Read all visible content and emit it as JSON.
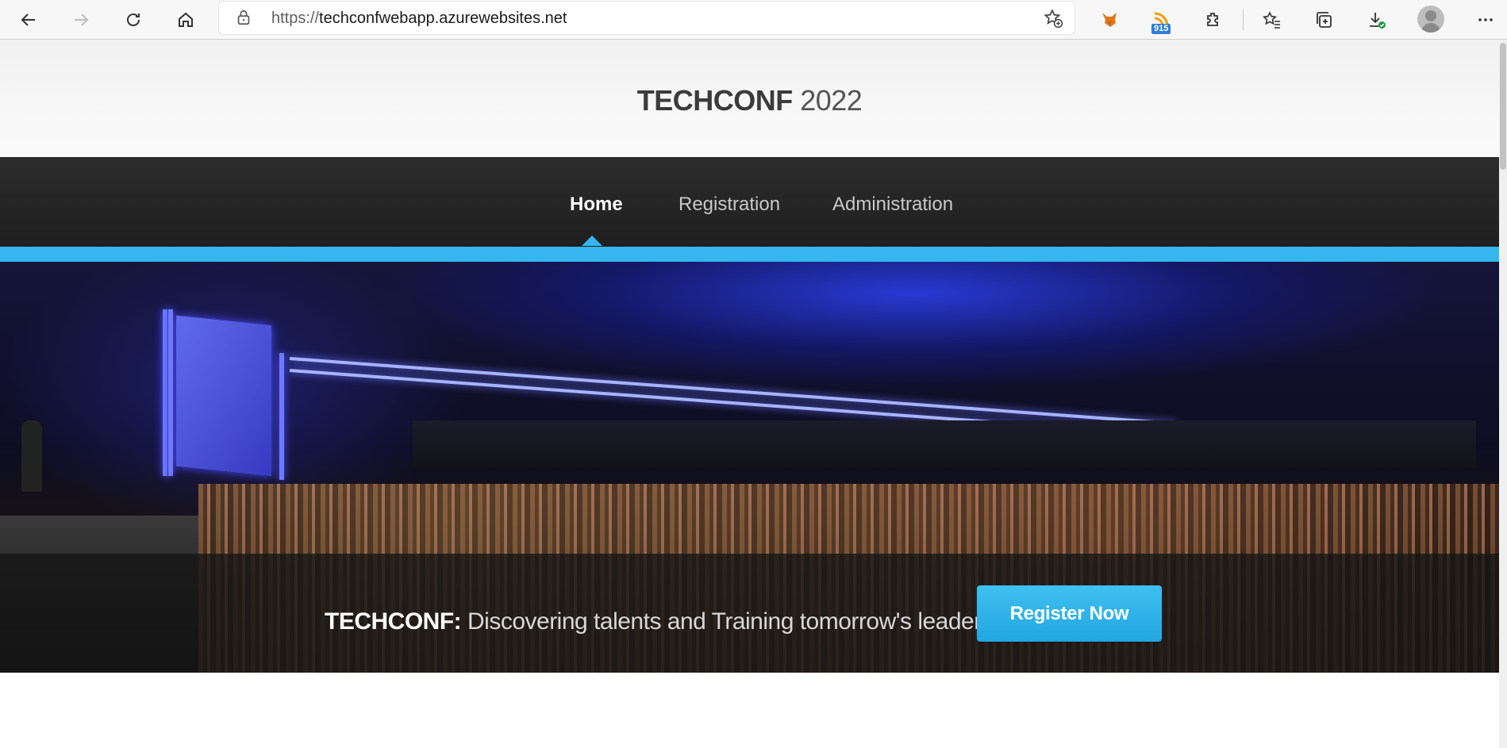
{
  "browser": {
    "url_scheme": "https://",
    "url_host": "techconfwebapp.azurewebsites.net",
    "extension_badge": "915",
    "icons": [
      "back-icon",
      "forward-icon",
      "refresh-icon",
      "home-icon",
      "lock-icon",
      "add-favorite-icon",
      "fox-extension-icon",
      "rss-extension-icon",
      "extensions-icon",
      "favorites-icon",
      "collections-icon",
      "downloads-icon",
      "profile-avatar",
      "more-icon"
    ]
  },
  "site": {
    "title_strong": "TECHCONF",
    "title_year": " 2022"
  },
  "nav": {
    "items": [
      {
        "label": "Home",
        "active": true
      },
      {
        "label": "Registration",
        "active": false
      },
      {
        "label": "Administration",
        "active": false
      }
    ]
  },
  "hero": {
    "tagline_brand": "TECHCONF:",
    "tagline_text": " Discovering talents and Training tomorrow's leaders",
    "cta_label": "Register Now"
  },
  "colors": {
    "accent": "#35b6ee",
    "nav_bg": "#262626",
    "cta": "#2eb2e8"
  }
}
